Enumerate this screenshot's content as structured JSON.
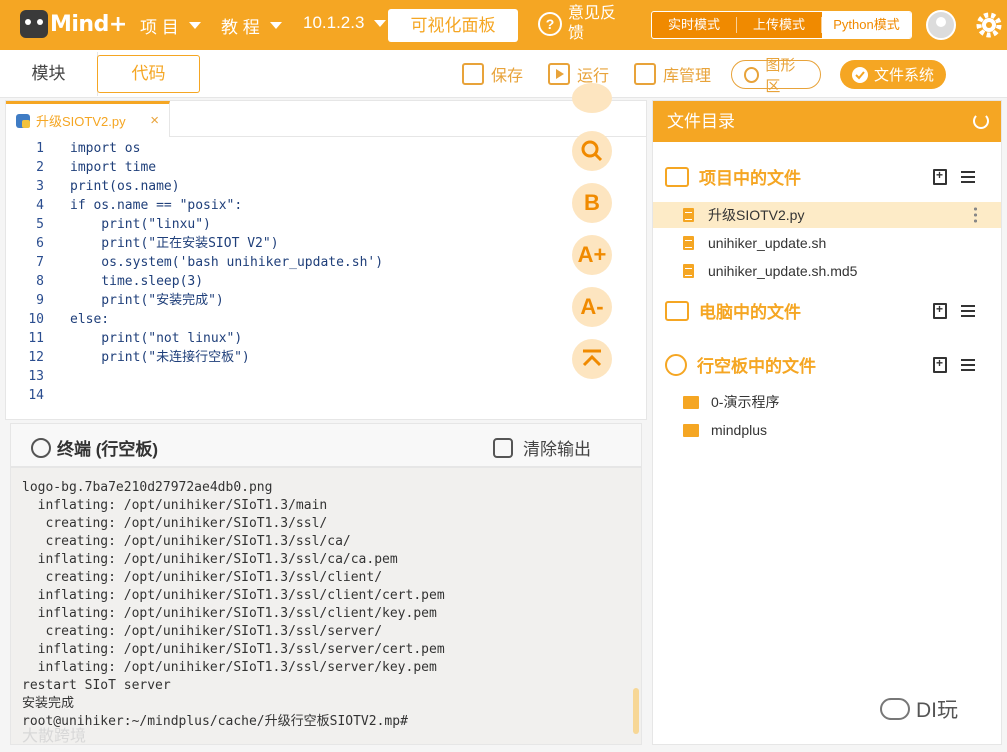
{
  "app": {
    "logo_text": "Mind+",
    "menus": [
      {
        "label": "项 目"
      },
      {
        "label": "教 程"
      },
      {
        "label": "10.1.2.3"
      }
    ],
    "visual_panel_button": "可视化面板",
    "feedback": "意见反馈",
    "modes": [
      "实时模式",
      "上传模式",
      "Python模式"
    ],
    "active_mode": "Python模式"
  },
  "toolbar": {
    "tab_blocks": "模块",
    "tab_code": "代码",
    "save": "保存",
    "run": "运行",
    "library": "库管理",
    "graphic_area": "图形区",
    "file_system": "文件系统"
  },
  "editor": {
    "file_tab": "升级SIOTV2.py",
    "close_glyph": "×",
    "lines": [
      "import os",
      "import time",
      "print(os.name)",
      "if os.name == \"posix\":",
      "    print(\"linxu\")",
      "    print(\"正在安装SIOT V2\")",
      "    os.system('bash unihiker_update.sh')",
      "    time.sleep(3)",
      "    print(\"安装完成\")",
      "else:",
      "    print(\"not linux\")",
      "    print(\"未连接行空板\")",
      "",
      ""
    ],
    "line_numbers": [
      "1",
      "2",
      "3",
      "4",
      "5",
      "6",
      "7",
      "8",
      "9",
      "10",
      "11",
      "12",
      "13",
      "14"
    ],
    "side_buttons": [
      "search-icon",
      "B",
      "A+",
      "A-",
      "collapse-icon"
    ]
  },
  "terminal": {
    "title": "终端 (行空板)",
    "clear_label": "清除输出",
    "output": "logo-bg.7ba7e210d27972ae4db0.png\n  inflating: /opt/unihiker/SIoT1.3/main\n   creating: /opt/unihiker/SIoT1.3/ssl/\n   creating: /opt/unihiker/SIoT1.3/ssl/ca/\n  inflating: /opt/unihiker/SIoT1.3/ssl/ca/ca.pem\n   creating: /opt/unihiker/SIoT1.3/ssl/client/\n  inflating: /opt/unihiker/SIoT1.3/ssl/client/cert.pem\n  inflating: /opt/unihiker/SIoT1.3/ssl/client/key.pem\n   creating: /opt/unihiker/SIoT1.3/ssl/server/\n  inflating: /opt/unihiker/SIoT1.3/ssl/server/cert.pem\n  inflating: /opt/unihiker/SIoT1.3/ssl/server/key.pem\nrestart SIoT server\n安装完成\nroot@unihiker:~/mindplus/cache/升级行空板SIOTV2.mp#"
  },
  "file_panel": {
    "header": "文件目录",
    "project_section": "项目中的文件",
    "project_files": [
      "升级SIOTV2.py",
      "unihiker_update.sh",
      "unihiker_update.sh.md5"
    ],
    "computer_section": "电脑中的文件",
    "board_section": "行空板中的文件",
    "board_folders": [
      "0-演示程序",
      "mindplus"
    ]
  },
  "watermark": {
    "brand": "DI玩",
    "faded": "大散跨境"
  },
  "colors": {
    "accent": "#f5a623",
    "accent_dark": "#f08a00",
    "selected_row": "#fdebc7",
    "terminal_bg": "#f1f0ee"
  }
}
